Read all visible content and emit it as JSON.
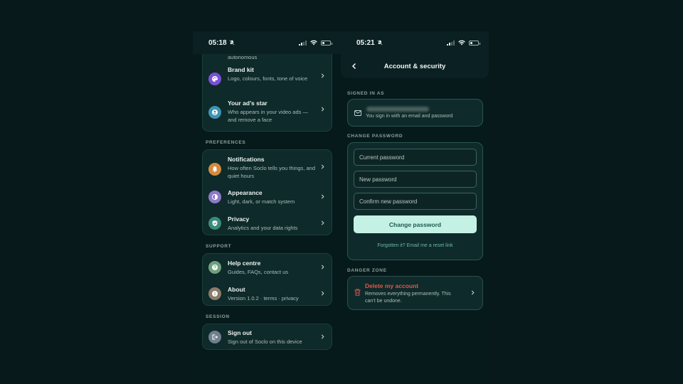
{
  "left_phone": {
    "status": {
      "time": "05:18"
    },
    "ghost_text": "autonomous",
    "account_card": [
      {
        "title": "Brand kit",
        "subtitle": "Logo, colours, fonts, tone of voice",
        "icon": "palette-icon",
        "color": "#7b4fd6"
      },
      {
        "title": "Your ad’s star",
        "subtitle": "Who appears in your video ads — and remove a face",
        "icon": "person-icon",
        "color": "#3f93b4"
      }
    ],
    "sections": {
      "preferences": "PREFERENCES",
      "support": "SUPPORT",
      "session": "SESSION"
    },
    "preferences": [
      {
        "title": "Notifications",
        "subtitle": "How often Soclo tells you things, and quiet hours",
        "icon": "bell-icon",
        "color": "#d48a3d"
      },
      {
        "title": "Appearance",
        "subtitle": "Light, dark, or match system",
        "icon": "contrast-icon",
        "color": "#8d7ac8"
      },
      {
        "title": "Privacy",
        "subtitle": "Analytics and your data rights",
        "icon": "shield-icon",
        "color": "#3b8a7a"
      }
    ],
    "support": [
      {
        "title": "Help centre",
        "subtitle": "Guides, FAQs, contact us",
        "icon": "question-icon",
        "color": "#6ea07d"
      },
      {
        "title": "About",
        "subtitle": "Version 1.0.2 · terms · privacy",
        "icon": "info-icon",
        "color": "#8c7b6a"
      }
    ],
    "session": [
      {
        "title": "Sign out",
        "subtitle": "Sign out of Soclo on this device",
        "icon": "sign-out-icon",
        "color": "#6f7f8d"
      }
    ]
  },
  "right_phone": {
    "status": {
      "time": "05:21"
    },
    "nav_title": "Account & security",
    "signed_in_label": "SIGNED IN AS",
    "signed_in_sub": "You sign in with an email and password",
    "change_password_label": "CHANGE PASSWORD",
    "fields": {
      "current": "Current password",
      "new": "New password",
      "confirm": "Confirm new password"
    },
    "change_button": "Change password",
    "forgot_link": "Forgotten it? Email me a reset link",
    "danger_label": "DANGER ZONE",
    "danger_title": "Delete my account",
    "danger_sub": "Removes everything permanently. This can’t be undone.",
    "colors": {
      "accent": "#c4f1e4",
      "danger": "#e2564a",
      "link": "#6fb6a6"
    }
  }
}
